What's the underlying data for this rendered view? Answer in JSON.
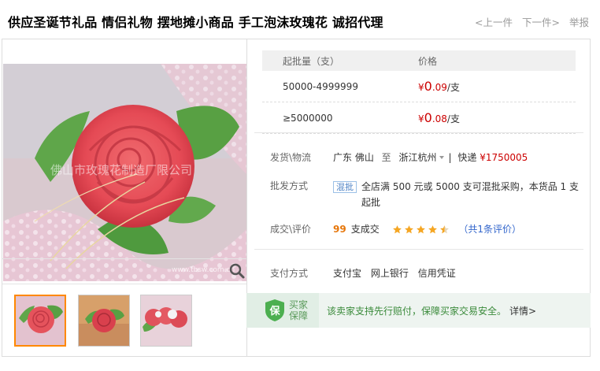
{
  "title": "供应圣诞节礼品 情侣礼物 摆地摊小商品 手工泡沫玫瑰花 诚招代理",
  "nav": {
    "prev": "<上一件",
    "next": "下一件>",
    "report": "举报"
  },
  "price_table": {
    "header": {
      "quantity": "起批量（支）",
      "price": "价格"
    },
    "rows": [
      {
        "quantity": "50000-4999999",
        "currency": "¥",
        "price_int": "0",
        "price_dec": ".09",
        "unit": "/支"
      },
      {
        "quantity": "≥5000000",
        "currency": "¥",
        "price_int": "0",
        "price_dec": ".08",
        "unit": "/支"
      }
    ]
  },
  "shipping": {
    "label": "发货\\物流",
    "from": "广东 佛山",
    "to_word": "至",
    "dest": "浙江杭州",
    "method": "快递",
    "fee": "¥1750005"
  },
  "wholesale": {
    "label": "批发方式",
    "badge": "混批",
    "text": "全店满 500 元或 5000 支可混批采购，本货品 1 支起批"
  },
  "deals": {
    "label": "成交\\评价",
    "count": "99",
    "count_unit": "支成交",
    "rating": 4.5,
    "reviews": "（共1条评价）"
  },
  "payment": {
    "label": "支付方式",
    "methods": [
      "支付宝",
      "网上银行",
      "信用凭证"
    ]
  },
  "guarantee": {
    "icon_char": "保",
    "label_line1": "买家",
    "label_line2": "保障",
    "text": "该卖家支持先行赔付，保障买家交易安全。",
    "link": "详情>"
  },
  "gallery": {
    "watermark": "佛山市玫瑰花制造厂限公司",
    "watermark_url": "www.tbsw.com.cn",
    "selected_thumb": 0
  },
  "colors": {
    "price_red": "#cc0000",
    "star_orange": "#f5a623",
    "guarantee_green": "#4caf50",
    "link_blue": "#3366cc"
  }
}
